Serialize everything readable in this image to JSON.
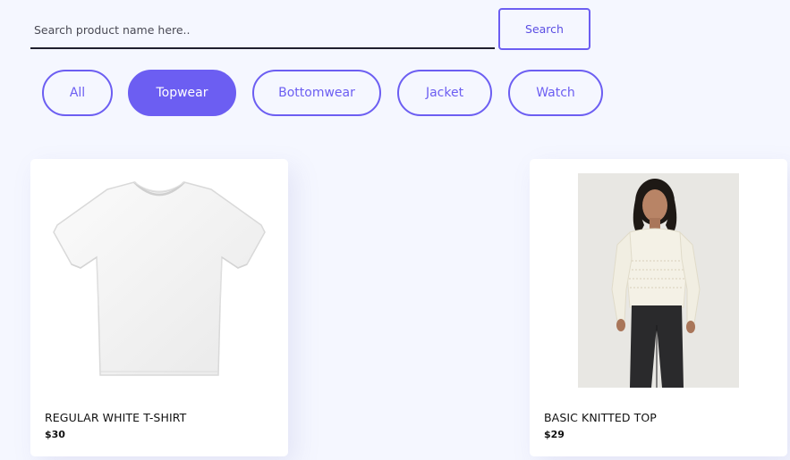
{
  "search": {
    "placeholder": "Search product name here..",
    "value": "",
    "button_label": "Search"
  },
  "filters": [
    {
      "label": "All",
      "active": false
    },
    {
      "label": "Topwear",
      "active": true
    },
    {
      "label": "Bottomwear",
      "active": false
    },
    {
      "label": "Jacket",
      "active": false
    },
    {
      "label": "Watch",
      "active": false
    }
  ],
  "products": [
    {
      "name": "REGULAR WHITE T-SHIRT",
      "price": "$30",
      "image": "white-tshirt-image"
    },
    {
      "name": "BASIC KNITTED TOP",
      "price": "$29",
      "image": "knitted-top-model-image"
    }
  ],
  "colors": {
    "accent": "#6c5ef2",
    "background": "#f5f7ff",
    "card": "#ffffff",
    "text": "#111111"
  }
}
